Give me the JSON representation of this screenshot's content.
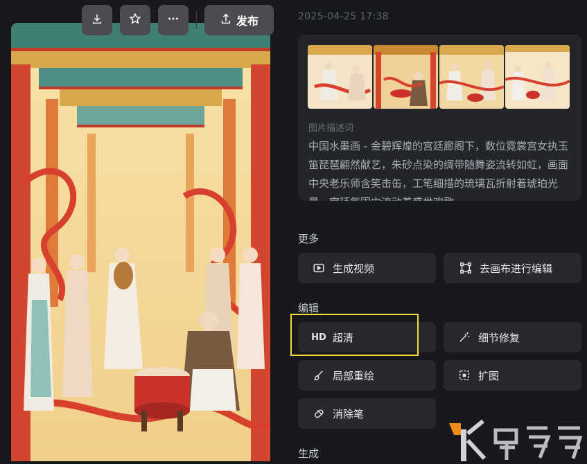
{
  "toolbar": {
    "download_icon": "download-icon",
    "star_icon": "star-icon",
    "more_icon": "more-icon",
    "publish_label": "发布"
  },
  "detail": {
    "timestamp": "2025-04-25 17:38",
    "desc_label": "图片描述词",
    "desc_text": "中国水墨画 - 金碧辉煌的宫廷廊阁下，数位霓裳宫女执玉笛琵琶翩然献艺，朱砂点染的绸带随舞姿流转如虹，画面中央老乐师含笑击缶，工笔细描的琉璃瓦折射着琥珀光晕，宫廷氛围中流动着盛世欢歌。"
  },
  "sections": {
    "more": "更多",
    "edit": "编辑",
    "generate": "生成"
  },
  "actions": {
    "gen_video": "生成视频",
    "canvas_edit": "去画布进行编辑",
    "hd_icon_text": "HD",
    "hd": "超清",
    "detail_fix": "细节修复",
    "local_repaint": "局部重绘",
    "expand": "扩图",
    "eraser": "消除笔"
  },
  "colors": {
    "background": "#17191d",
    "card": "#232529",
    "button": "#27292e",
    "highlight": "#f4dd3a"
  }
}
